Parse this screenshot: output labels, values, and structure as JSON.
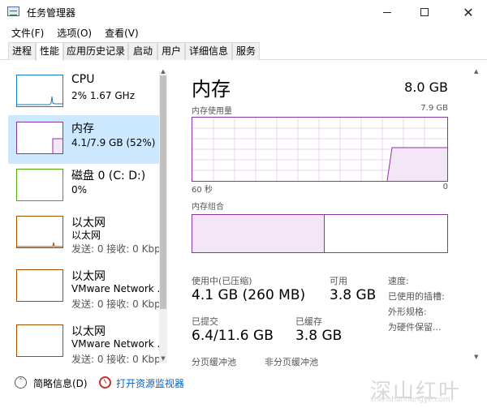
{
  "window": {
    "title": "任务管理器"
  },
  "menu": [
    "文件(F)",
    "选项(O)",
    "查看(V)"
  ],
  "tabs": [
    "进程",
    "性能",
    "应用历史记录",
    "启动",
    "用户",
    "详细信息",
    "服务"
  ],
  "active_tab": "性能",
  "sidebar": {
    "items": [
      {
        "title": "CPU",
        "line1": "2% 1.67 GHz",
        "line2": "",
        "color": "#117dbb"
      },
      {
        "title": "内存",
        "line1": "4.1/7.9 GB (52%)",
        "line2": "",
        "color": "#8b34a6"
      },
      {
        "title": "磁盘 0 (C: D:)",
        "line1": "0%",
        "line2": "",
        "color": "#4da60c"
      },
      {
        "title": "以太网",
        "line1": "以太网",
        "line2": "发送: 0 接收: 0 Kbp",
        "color": "#a74f01"
      },
      {
        "title": "以太网",
        "line1": "VMware Network ...",
        "line2": "发送: 0 接收: 0 Kbp",
        "color": "#a74f01"
      },
      {
        "title": "以太网",
        "line1": "VMware Network ...",
        "line2": "发送: 0 接收: 0 Kbp",
        "color": "#a74f01"
      }
    ]
  },
  "memory": {
    "title": "内存",
    "total": "8.0 GB",
    "usage_label": "内存使用量",
    "usage_max": "7.9 GB",
    "axis_left": "60 秒",
    "axis_right": "0",
    "composition_label": "内存组合",
    "composition_used_fraction": 0.52,
    "in_use_label": "使用中(已压缩)",
    "in_use_value": "4.1 GB (260 MB)",
    "available_label": "可用",
    "available_value": "3.8 GB",
    "committed_label": "已提交",
    "committed_value": "6.4/11.6 GB",
    "cached_label": "已缓存",
    "cached_value": "3.8 GB",
    "paged_label": "分页缓冲池",
    "nonpaged_label": "非分页缓冲池",
    "speed_label": "速度:",
    "slots_label": "已使用的插槽:",
    "form_label": "外形规格:",
    "reserved_label": "为硬件保留..."
  },
  "footer": {
    "less_details": "简略信息(D)",
    "resource_monitor": "打开资源监视器"
  },
  "watermark": {
    "logo": "深山红叶",
    "url": "shenshanhongye.com"
  },
  "colors": {
    "cpu": "#117dbb",
    "memory": "#8b34a6",
    "disk": "#4da60c",
    "ethernet": "#a74f01",
    "selected_bg": "#cce8ff",
    "link": "#0066cc"
  }
}
